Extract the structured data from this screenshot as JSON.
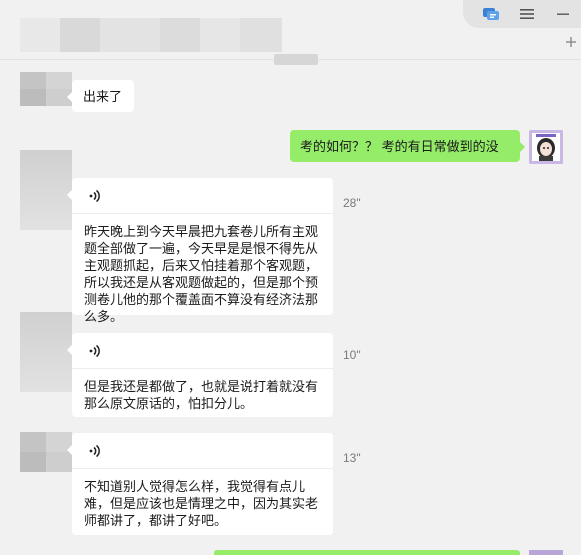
{
  "window": {
    "controls": {
      "chat_icon": "chat-bubbles-icon",
      "menu_icon": "hamburger-menu-icon",
      "minimize_icon": "minimize-icon",
      "pin_icon": "pin-icon"
    }
  },
  "messages": [
    {
      "id": "m1",
      "side": "left",
      "type": "text",
      "text": "出来了"
    },
    {
      "id": "m2",
      "side": "right",
      "type": "text",
      "text": "考的如何？？ 考的有日常做到的没"
    },
    {
      "id": "m3",
      "side": "left",
      "type": "voice",
      "duration": "28\"",
      "transcript": "昨天晚上到今天早晨把九套卷儿所有主观题全部做了一遍，今天早是是恨不得先从主观题抓起，后来又怕挂着那个客观题，所以我还是从客观题做起的，但是那个预测卷儿他的那个覆盖面不算没有经济法那么多。"
    },
    {
      "id": "m4",
      "side": "left",
      "type": "voice",
      "duration": "10\"",
      "transcript": "但是我还是都做了，也就是说打着就没有那么原文原话的，怕扣分儿。"
    },
    {
      "id": "m5",
      "side": "left",
      "type": "voice",
      "duration": "13\"",
      "transcript": "不知道别人觉得怎么样，我觉得有点儿难，但是应该也是情理之中，因为其实老师都讲了，都讲了好吧。"
    }
  ],
  "colors": {
    "sent_bubble": "#95ec69",
    "received_bubble": "#ffffff",
    "background": "#f1f1f1"
  }
}
